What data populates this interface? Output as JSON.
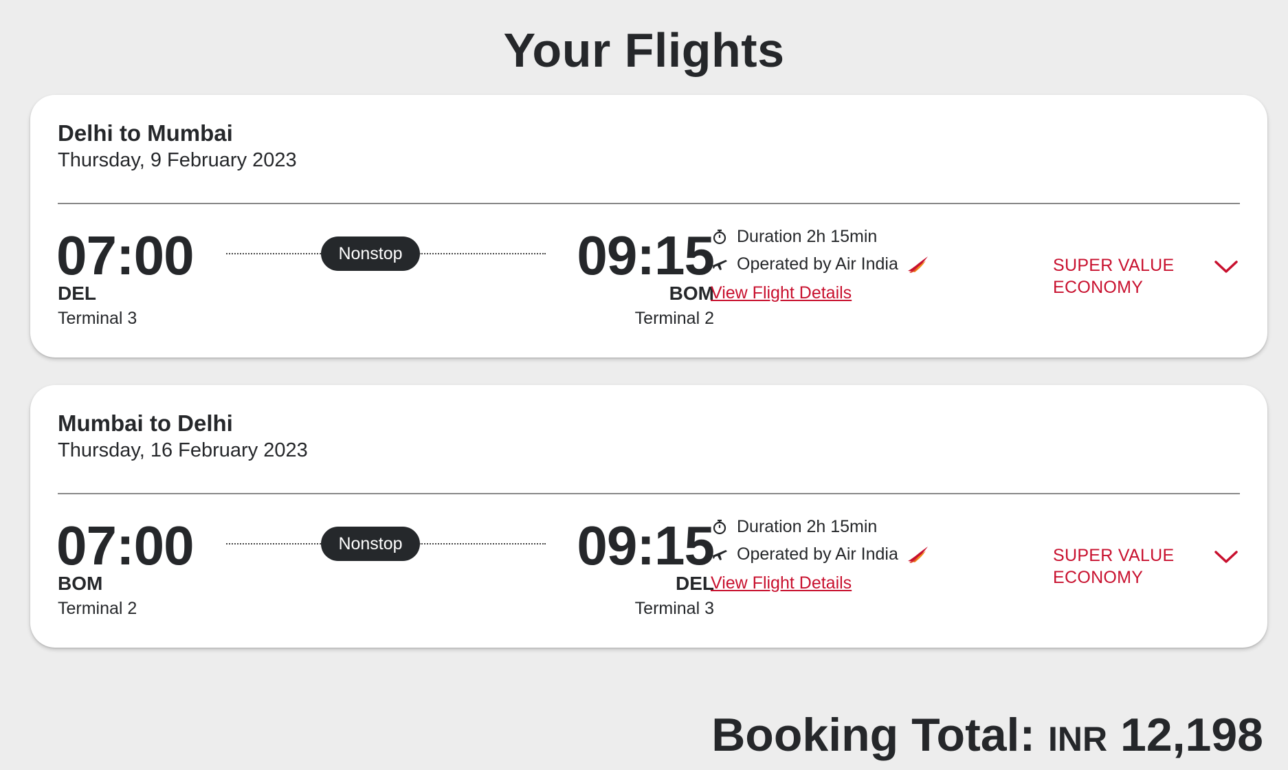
{
  "page": {
    "title": "Your Flights"
  },
  "flights": [
    {
      "route": "Delhi to Mumbai",
      "date": "Thursday, 9 February 2023",
      "departure": {
        "time": "07:00",
        "code": "DEL",
        "terminal": "Terminal 3"
      },
      "arrival": {
        "time": "09:15",
        "code": "BOM",
        "terminal": "Terminal 2"
      },
      "stops": "Nonstop",
      "duration": "Duration 2h 15min",
      "operator": "Operated by Air India",
      "details_link": "View Flight Details",
      "fare_class": "SUPER VALUE ECONOMY"
    },
    {
      "route": "Mumbai to Delhi",
      "date": "Thursday, 16 February 2023",
      "departure": {
        "time": "07:00",
        "code": "BOM",
        "terminal": "Terminal 2"
      },
      "arrival": {
        "time": "09:15",
        "code": "DEL",
        "terminal": "Terminal 3"
      },
      "stops": "Nonstop",
      "duration": "Duration 2h 15min",
      "operator": "Operated by Air India",
      "details_link": "View Flight Details",
      "fare_class": "SUPER VALUE ECONOMY"
    }
  ],
  "booking_total": {
    "label": "Booking Total:",
    "currency": "INR",
    "amount": "12,198"
  },
  "icons": {
    "duration": "stopwatch-icon",
    "operator": "plane-icon",
    "airline_logo": "air-india-logo",
    "expand": "chevron-down-icon"
  },
  "colors": {
    "accent": "#c8102e",
    "text": "#25272a",
    "badge": "#25282b",
    "background": "#ededed"
  }
}
